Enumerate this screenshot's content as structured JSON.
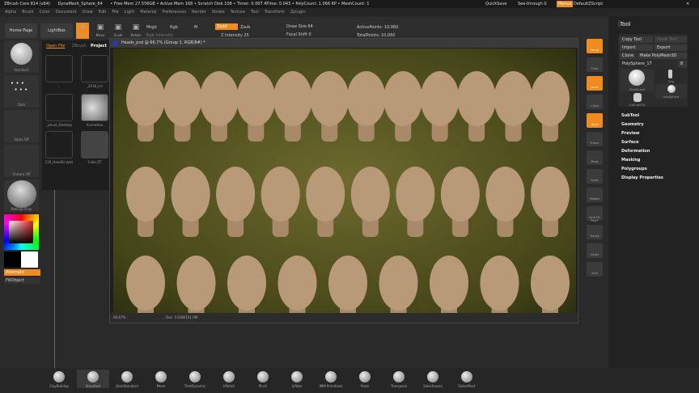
{
  "titlebar": {
    "app": "ZBrush Core 814 (x64)",
    "doc": "DynaMesh_Sphere_64",
    "stats": "• Free Mem 27.556GB • Active Mem 168 • Scratch Disk 108 • Timer: 0.007 ATime: 0.043 • PolyCount: 1.066 KP • MeshCount: 1",
    "quicksave": "QuickSave",
    "seethrough": "See-through 0",
    "menus": "Menus",
    "script": "DefaultZScript"
  },
  "menu": [
    "Alpha",
    "Brush",
    "Color",
    "Document",
    "Draw",
    "Edit",
    "File",
    "Light",
    "Material",
    "Preferences",
    "Render",
    "Stroke",
    "Texture",
    "Tool",
    "Transform",
    "Zplugin"
  ],
  "shelf": {
    "home": "Home Page",
    "lightbox": "LightBox",
    "draw": "Draw",
    "move": "Move",
    "scale": "Scale",
    "rotate": "Rotate",
    "mrgb": "Mrgb",
    "rgb": "Rgb",
    "m": "M",
    "rgb_intensity": "Rgb Intensity",
    "zadd": "Zadd",
    "zsub": "Zsub",
    "z_intensity": "Z Intensity 25",
    "draw_size": "Draw Size 64",
    "focal_shift": "Focal Shift 0",
    "active_points": "ActivePoints: 10,060",
    "total_points": "TotalPoints: 10,060"
  },
  "left": {
    "brush": "Standard",
    "stroke": "Dots",
    "alpha": "Alpha Off",
    "texture": "Texture Off",
    "material": "MatCap Gray",
    "alternate": "Alternate",
    "fillobject": "FillObject"
  },
  "lightbox": {
    "tabs": [
      "Open File",
      "ZBrush",
      "Project"
    ],
    "items": [
      "..",
      "_2018_Lin",
      "_jdrust_Desktop",
      "AnimeHea",
      "116_HeadSculpts",
      "Cube.ZT"
    ]
  },
  "ps": {
    "title": "Heads_psd @ 66.7% (Group 1, RGB/8#) *",
    "zoom": "66.67%",
    "doc": "Doc: 5.93M/151.0M"
  },
  "righttools": [
    "Persp",
    "Floor",
    "Local",
    "L.Sym",
    "Qxyz",
    "Frame",
    "Move",
    "Scale",
    "Rotate",
    "Line Fill PolyF",
    "Transp",
    "Ghost",
    "Solo"
  ],
  "toolpanel": {
    "title": "Tool",
    "copy": "Copy Tool",
    "paste": "Paste Tool",
    "import": "Import",
    "export": "Export",
    "clone": "Clone",
    "make": "Make PolyMesh3D",
    "current": "PolySphere_17",
    "current_value": "8",
    "thumbs": [
      "PolySphere",
      "Dog",
      "PolySphere",
      "Cylinder3D"
    ],
    "sections": [
      "SubTool",
      "Geometry",
      "Preview",
      "Surface",
      "Deformation",
      "Masking",
      "Polygroups",
      "Display Properties"
    ]
  },
  "brushes": [
    "ClayBuildup",
    "Standard",
    "DamStandard",
    "Move",
    "TrimDynamic",
    "hPolish",
    "Pinch",
    "Inflate",
    "IMM Primitives",
    "Paint",
    "Transpose",
    "SelectLasso",
    "SelectRect"
  ],
  "colors": {
    "accent": "#f08c1e",
    "canvas": "#5c5a24",
    "head": "#b89a78"
  }
}
